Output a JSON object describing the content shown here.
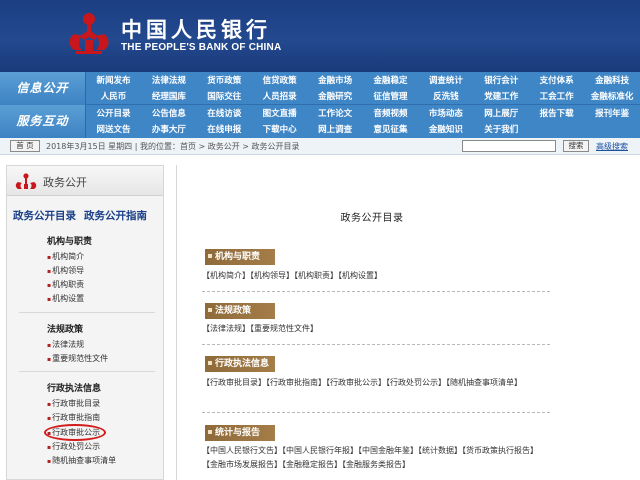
{
  "header": {
    "title_cn": "中国人民银行",
    "title_en": "THE PEOPLE'S BANK OF CHINA",
    "emblem_icon": "pboc-emblem-icon",
    "brand_red": "#c8161d"
  },
  "nav": {
    "section1": "信息公开",
    "section2": "服务互动",
    "row1": [
      [
        "新闻发布",
        "法律法规",
        "货币政策",
        "信贷政策",
        "金融市场",
        "金融稳定",
        "调查统计",
        "银行会计",
        "支付体系",
        "金融科技"
      ],
      [
        "人民币",
        "经理国库",
        "国际交往",
        "人员招录",
        "金融研究",
        "征信管理",
        "反洗钱",
        "党建工作",
        "工会工作",
        "金融标准化"
      ]
    ],
    "row2": [
      [
        "公开目录",
        "公告信息",
        "在线访谈",
        "图文直播",
        "工作论文",
        "音频视频",
        "市场动态",
        "网上展厅",
        "报告下载",
        "报刊年鉴"
      ],
      [
        "网送文告",
        "办事大厅",
        "在线申报",
        "下载中心",
        "网上调查",
        "意见征集",
        "金融知识",
        "关于我们"
      ]
    ]
  },
  "crumbbar": {
    "home_label": "首 页",
    "text": "2018年3月15日 星期四 | 我的位置：首页 > 政务公开 > 政务公开目录",
    "search_placeholder": "",
    "search_button": "搜索",
    "advanced": "高级搜索"
  },
  "sidebar": {
    "title": "政务公开",
    "link1": "政务公开目录",
    "link2": "政务公开指南",
    "group1": "机构与职责",
    "group1_items": [
      "机构简介",
      "机构领导",
      "机构职责",
      "机构设置"
    ],
    "group2": "法规政策",
    "group2_items": [
      "法律法规",
      "重要规范性文件"
    ],
    "group3": "行政执法信息",
    "group3_items": [
      "行政审批目录",
      "行政审批指南",
      "行政审批公示",
      "行政处罚公示",
      "随机抽查事项清单"
    ]
  },
  "main": {
    "title": "政务公开目录",
    "sections": [
      {
        "head": "机构与职责",
        "items": "【机构简介】【机构领导】【机构职责】【机构设置】"
      },
      {
        "head": "法规政策",
        "items": "【法律法规】【重要规范性文件】"
      },
      {
        "head": "行政执法信息",
        "items": "【行政审批目录】【行政审批指南】【行政审批公示】【行政处罚公示】【随机抽查事项清单】"
      },
      {
        "head": "统计与报告",
        "items": "【中国人民银行文告】【中国人民银行年报】【中国金融年鉴】【统计数据】【货币政策执行报告】【金融市场发展报告】【金融稳定报告】【金融服务类报告】"
      }
    ]
  }
}
